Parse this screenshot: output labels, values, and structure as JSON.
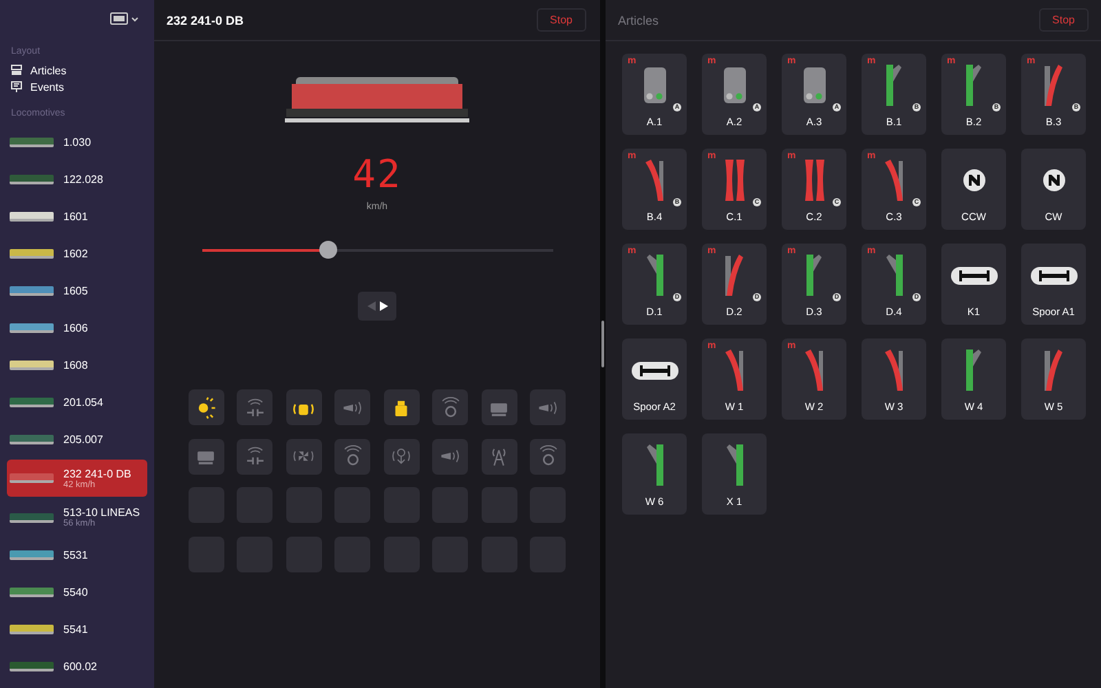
{
  "sidebar": {
    "sections": [
      {
        "title": "Layout",
        "items": [
          {
            "label": "Articles"
          },
          {
            "label": "Events"
          }
        ]
      }
    ],
    "locomotives_title": "Locomotives",
    "locomotives": [
      {
        "name": "1.030",
        "color": "#3f6b45",
        "selected": false
      },
      {
        "name": "122.028",
        "color": "#2f5a3a",
        "selected": false
      },
      {
        "name": "1601",
        "color": "#d8d8d0",
        "selected": false
      },
      {
        "name": "1602",
        "color": "#c9b848",
        "selected": false
      },
      {
        "name": "1605",
        "color": "#4f8fb8",
        "selected": false
      },
      {
        "name": "1606",
        "color": "#5a9ec0",
        "selected": false
      },
      {
        "name": "1608",
        "color": "#d8cc88",
        "selected": false
      },
      {
        "name": "201.054",
        "color": "#2f6a48",
        "selected": false
      },
      {
        "name": "205.007",
        "color": "#3a6a58",
        "selected": false
      },
      {
        "name": "232 241-0 DB",
        "speed": "42 km/h",
        "color": "#c85050",
        "selected": true
      },
      {
        "name": "513-10 LINEAS",
        "speed": "56 km/h",
        "color": "#2a5a48",
        "selected": false
      },
      {
        "name": "5531",
        "color": "#4a9ab0",
        "selected": false
      },
      {
        "name": "5540",
        "color": "#4a8a50",
        "selected": false
      },
      {
        "name": "5541",
        "color": "#c8b840",
        "selected": false
      },
      {
        "name": "600.02",
        "color": "#2a5a30",
        "selected": false
      }
    ]
  },
  "control": {
    "title": "232 241-0 DB",
    "stop": "Stop",
    "speed": "42",
    "unit": "km/h",
    "level": 0.36,
    "forward": true,
    "functions": [
      {
        "kind": "light",
        "on": true
      },
      {
        "kind": "coupler",
        "on": false
      },
      {
        "kind": "cab",
        "on": true
      },
      {
        "kind": "horn",
        "on": false
      },
      {
        "kind": "weight",
        "on": true
      },
      {
        "kind": "sound",
        "on": false
      },
      {
        "kind": "loco",
        "on": false
      },
      {
        "kind": "horn",
        "on": false
      },
      {
        "kind": "loco",
        "on": false
      },
      {
        "kind": "coupler",
        "on": false
      },
      {
        "kind": "fan",
        "on": false
      },
      {
        "kind": "sound",
        "on": false
      },
      {
        "kind": "smoke",
        "on": false
      },
      {
        "kind": "horn",
        "on": false
      },
      {
        "kind": "antenna",
        "on": false
      },
      {
        "kind": "sound",
        "on": false
      },
      {
        "kind": "empty"
      },
      {
        "kind": "empty"
      },
      {
        "kind": "empty"
      },
      {
        "kind": "empty"
      },
      {
        "kind": "empty"
      },
      {
        "kind": "empty"
      },
      {
        "kind": "empty"
      },
      {
        "kind": "empty"
      },
      {
        "kind": "empty"
      },
      {
        "kind": "empty"
      },
      {
        "kind": "empty"
      },
      {
        "kind": "empty"
      },
      {
        "kind": "empty"
      },
      {
        "kind": "empty"
      },
      {
        "kind": "empty"
      },
      {
        "kind": "empty"
      }
    ]
  },
  "articles": {
    "title": "Articles",
    "stop": "Stop",
    "items": [
      {
        "label": "A.1",
        "kind": "signal",
        "flag": "m",
        "badge": "A"
      },
      {
        "label": "A.2",
        "kind": "signal",
        "flag": "m",
        "badge": "A"
      },
      {
        "label": "A.3",
        "kind": "signal",
        "flag": "m",
        "badge": "A"
      },
      {
        "label": "B.1",
        "kind": "rightturnout",
        "thrown": false,
        "flag": "m",
        "badge": "B"
      },
      {
        "label": "B.2",
        "kind": "rightturnout",
        "thrown": false,
        "flag": "m",
        "badge": "B"
      },
      {
        "label": "B.3",
        "kind": "rightturnout",
        "thrown": true,
        "flag": "m",
        "badge": "B"
      },
      {
        "label": "B.4",
        "kind": "leftturnout",
        "thrown": true,
        "flag": "m",
        "badge": "B"
      },
      {
        "label": "C.1",
        "kind": "crossing",
        "thrown": true,
        "flag": "m",
        "badge": "C"
      },
      {
        "label": "C.2",
        "kind": "crossing",
        "thrown": true,
        "flag": "m",
        "badge": "C"
      },
      {
        "label": "C.3",
        "kind": "leftturnout",
        "thrown": true,
        "flag": "m",
        "badge": "C"
      },
      {
        "label": "CCW",
        "kind": "turntable"
      },
      {
        "label": "CW",
        "kind": "turntable"
      },
      {
        "label": "D.1",
        "kind": "leftturnout",
        "thrown": false,
        "flag": "m",
        "badge": "D"
      },
      {
        "label": "D.2",
        "kind": "rightturnout",
        "thrown": true,
        "flag": "m",
        "badge": "D"
      },
      {
        "label": "D.3",
        "kind": "rightturnout",
        "thrown": false,
        "flag": "m",
        "badge": "D"
      },
      {
        "label": "D.4",
        "kind": "leftturnout",
        "thrown": false,
        "flag": "m",
        "badge": "D"
      },
      {
        "label": "K1",
        "kind": "track"
      },
      {
        "label": "Spoor A1",
        "kind": "track"
      },
      {
        "label": "Spoor A2",
        "kind": "track"
      },
      {
        "label": "W 1",
        "kind": "leftturnout",
        "thrown": true,
        "flag": "m"
      },
      {
        "label": "W 2",
        "kind": "leftturnout",
        "thrown": true,
        "flag": "m"
      },
      {
        "label": "W 3",
        "kind": "leftturnout",
        "thrown": true
      },
      {
        "label": "W 4",
        "kind": "rightturnout",
        "thrown": false
      },
      {
        "label": "W 5",
        "kind": "rightturnout",
        "thrown": true
      },
      {
        "label": "W 6",
        "kind": "leftturnout",
        "thrown": false
      },
      {
        "label": "X 1",
        "kind": "leftturnout",
        "thrown": false
      }
    ]
  }
}
